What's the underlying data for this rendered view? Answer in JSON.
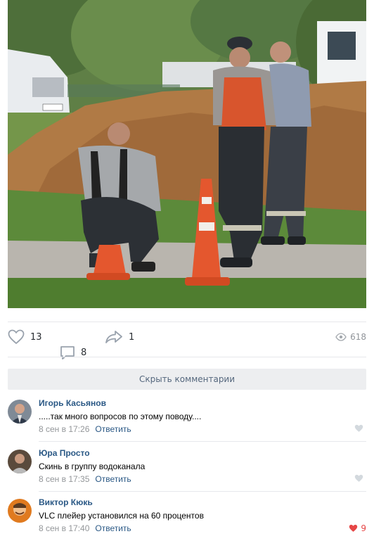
{
  "post": {
    "likes": "13",
    "comments": "8",
    "shares": "1",
    "views": "618"
  },
  "hide_comments_label": "Скрыть комментарии",
  "comments": [
    {
      "author": "Игорь Касьянов",
      "text": ".....так много вопросов по этому поводу....",
      "date": "8 сен в 17:26",
      "reply_label": "Ответить",
      "likes": ""
    },
    {
      "author": "Юра Просто",
      "text": "Скинь в группу водоканала",
      "date": "8 сен в 17:35",
      "reply_label": "Ответить",
      "likes": ""
    },
    {
      "author": "Виктор Кюкь",
      "text": "VLC плейер установился на 60 процентов",
      "date": "8 сен в 17:40",
      "reply_label": "Ответить",
      "likes": "9"
    }
  ],
  "colors": {
    "link": "#2a5885",
    "like_active": "#e64646",
    "icon": "#99a2ad"
  }
}
